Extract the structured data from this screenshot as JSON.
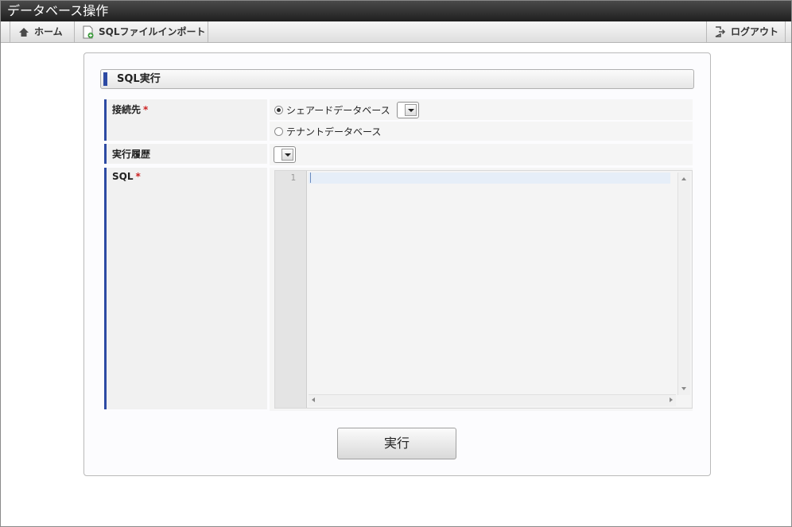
{
  "window": {
    "title": "データベース操作"
  },
  "toolbar": {
    "home_label": "ホーム",
    "sql_import_label": "SQLファイルインポート",
    "logout_label": "ログアウト"
  },
  "section": {
    "title": "SQL実行"
  },
  "form": {
    "connection": {
      "label": "接続先",
      "required_mark": "*",
      "options": [
        {
          "label": "シェアードデータベース",
          "selected": true
        },
        {
          "label": "テナントデータベース",
          "selected": false
        }
      ]
    },
    "history": {
      "label": "実行履歴"
    },
    "sql": {
      "label": "SQL",
      "required_mark": "*",
      "line_number": "1"
    }
  },
  "actions": {
    "run_label": "実行"
  },
  "colors": {
    "accent": "#2d4aa3",
    "required": "#cc2222"
  }
}
